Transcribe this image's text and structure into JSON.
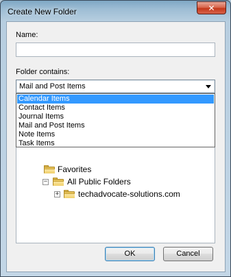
{
  "window": {
    "title": "Create New Folder",
    "close_glyph": "✕"
  },
  "form": {
    "name_label": "Name:",
    "name_value": "",
    "contains_label": "Folder contains:",
    "contains_selected": "Mail and Post Items"
  },
  "dropdown": {
    "options": [
      "Calendar Items",
      "Contact Items",
      "Journal Items",
      "Mail and Post Items",
      "Note Items",
      "Task Items"
    ],
    "highlighted_index": 0
  },
  "tree": {
    "items": [
      {
        "label": "Favorites",
        "icon": "folder-icon"
      },
      {
        "label": "All Public Folders",
        "icon": "folder-icon",
        "expander": "−"
      },
      {
        "label": "techadvocate-solutions.com",
        "icon": "folder-icon",
        "expander": "+"
      }
    ]
  },
  "buttons": {
    "ok": "OK",
    "cancel": "Cancel"
  }
}
